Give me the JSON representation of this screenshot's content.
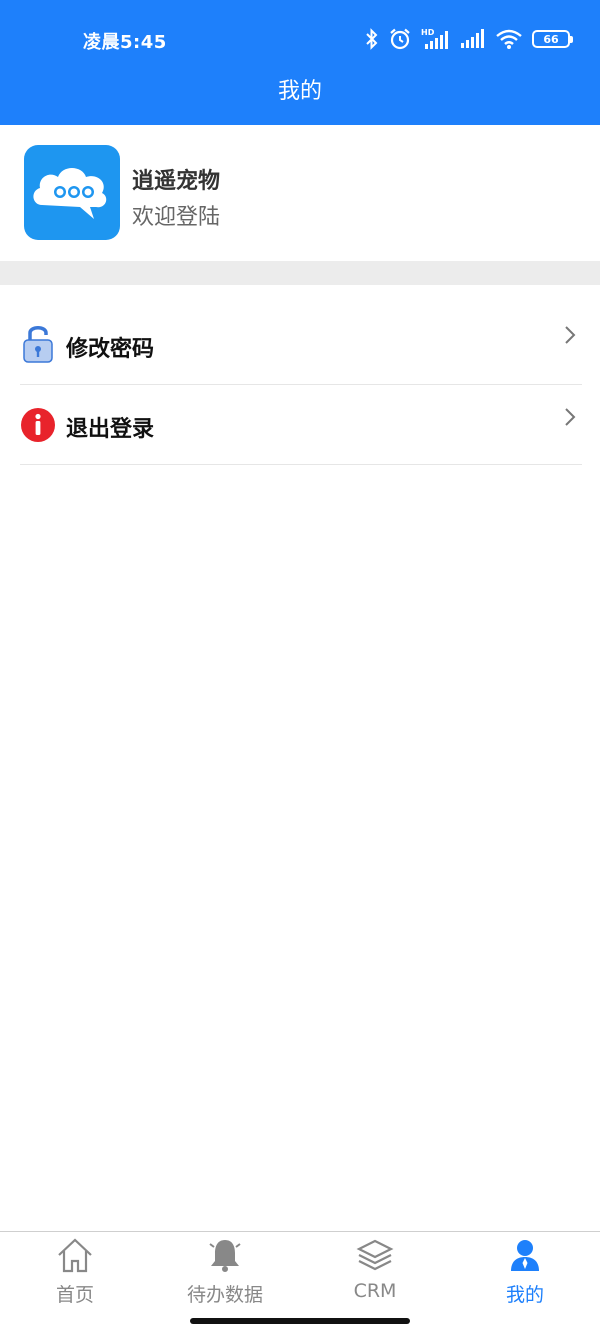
{
  "status_bar": {
    "time": "凌晨5:45",
    "battery": "66",
    "icons": [
      "bluetooth-icon",
      "alarm-icon",
      "hd-signal-icon",
      "signal-icon",
      "wifi-icon",
      "battery-icon"
    ]
  },
  "header": {
    "title": "我的"
  },
  "profile": {
    "app_name": "逍遥宠物",
    "subtitle": "欢迎登陆",
    "logo_icon": "cloud-chat-logo"
  },
  "menu": {
    "items": [
      {
        "label": "修改密码",
        "icon": "lock-icon"
      },
      {
        "label": "退出登录",
        "icon": "info-alert-icon"
      }
    ]
  },
  "tabbar": {
    "tabs": [
      {
        "label": "首页",
        "icon": "home-icon",
        "active": false
      },
      {
        "label": "待办数据",
        "icon": "bell-icon",
        "active": false
      },
      {
        "label": "CRM",
        "icon": "layers-icon",
        "active": false
      },
      {
        "label": "我的",
        "icon": "user-icon",
        "active": true
      }
    ]
  },
  "colors": {
    "primary": "#1e80fb",
    "logo_bg": "#1e96f0",
    "alert_red": "#e8232b",
    "inactive_tab": "#888888",
    "divider_band": "#ececec"
  }
}
